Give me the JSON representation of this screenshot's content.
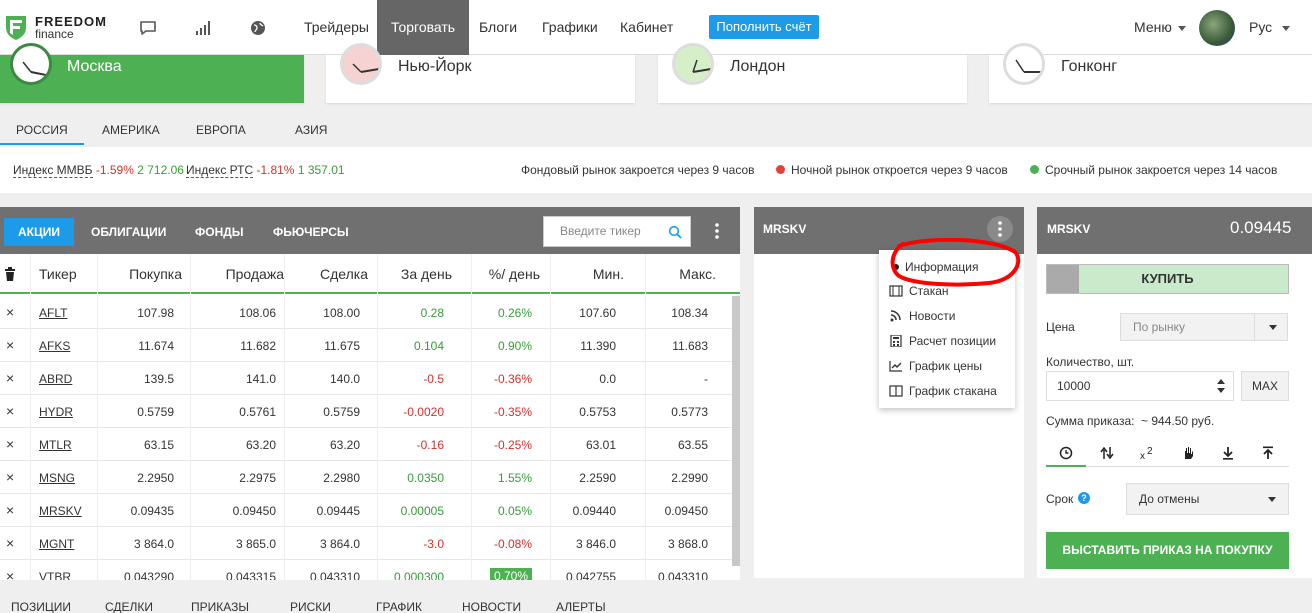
{
  "header": {
    "logo_top": "FREEDOM",
    "logo_bottom": "finance",
    "nav": [
      "Трейдеры",
      "Торговать",
      "Блоги",
      "Графики",
      "Кабинет"
    ],
    "deposit": "Пополнить счёт",
    "menu": "Меню",
    "lang": "Рус"
  },
  "clocks": [
    "Москва",
    "Нью-Йорк",
    "Лондон",
    "Гонконг"
  ],
  "regions": [
    "РОССИЯ",
    "АМЕРИКА",
    "ЕВРОПА",
    "АЗИЯ"
  ],
  "indices": {
    "micex_label": "Индекс ММВБ",
    "micex_change": "-1.59%",
    "micex_value": "2 712.06",
    "rts_label": "Индекс РТС",
    "rts_change": "-1.81%",
    "rts_value": "1 357.01",
    "stock_status": "Фондовый рынок закроется через 9 часов",
    "night_status": "Ночной рынок откроется через 9 часов",
    "futures_status": "Срочный рынок закроется через 14 часов",
    "night_color": "#e2403a",
    "futures_color": "#4db153"
  },
  "table_tabs": [
    "АКЦИИ",
    "ОБЛИГАЦИИ",
    "ФОНДЫ",
    "ФЬЮЧЕРСЫ"
  ],
  "ticker_placeholder": "Введите тикер",
  "columns": [
    "Тикер",
    "Покупка",
    "Продажа",
    "Сделка",
    "За день",
    "%/ день",
    "Мин.",
    "Макс."
  ],
  "rows": [
    {
      "ticker": "AFLT",
      "bid": "107.98",
      "ask": "108.06",
      "last": "108.00",
      "chg": "0.28",
      "pct": "0.26%",
      "min": "107.60",
      "max": "108.34",
      "dir": "up"
    },
    {
      "ticker": "AFKS",
      "bid": "11.674",
      "ask": "11.682",
      "last": "11.675",
      "chg": "0.104",
      "pct": "0.90%",
      "min": "11.390",
      "max": "11.683",
      "dir": "up"
    },
    {
      "ticker": "ABRD",
      "bid": "139.5",
      "ask": "141.0",
      "last": "140.0",
      "chg": "-0.5",
      "pct": "-0.36%",
      "min": "0.0",
      "max": "-",
      "dir": "down"
    },
    {
      "ticker": "HYDR",
      "bid": "0.5759",
      "ask": "0.5761",
      "last": "0.5759",
      "chg": "-0.0020",
      "pct": "-0.35%",
      "min": "0.5753",
      "max": "0.5773",
      "dir": "down"
    },
    {
      "ticker": "MTLR",
      "bid": "63.15",
      "ask": "63.20",
      "last": "63.20",
      "chg": "-0.16",
      "pct": "-0.25%",
      "min": "63.01",
      "max": "63.55",
      "dir": "down"
    },
    {
      "ticker": "MSNG",
      "bid": "2.2950",
      "ask": "2.2975",
      "last": "2.2980",
      "chg": "0.0350",
      "pct": "1.55%",
      "min": "2.2590",
      "max": "2.2990",
      "dir": "up"
    },
    {
      "ticker": "MRSKV",
      "bid": "0.09435",
      "ask": "0.09450",
      "last": "0.09445",
      "chg": "0.00005",
      "pct": "0.05%",
      "min": "0.09440",
      "max": "0.09450",
      "dir": "up"
    },
    {
      "ticker": "MGNT",
      "bid": "3 864.0",
      "ask": "3 865.0",
      "last": "3 864.0",
      "chg": "-3.0",
      "pct": "-0.08%",
      "min": "3 846.0",
      "max": "3 868.0",
      "dir": "down"
    },
    {
      "ticker": "VTBR",
      "bid": "0.043290",
      "ask": "0.043315",
      "last": "0.043310",
      "chg": "0.000300",
      "pct": "0.70%",
      "min": "0.042755",
      "max": "0.043310",
      "dir": "up"
    }
  ],
  "middle": {
    "title": "MRSKV",
    "menu": [
      "Информация",
      "Стакан",
      "Новости",
      "Расчет позиции",
      "График цены",
      "График стакана"
    ]
  },
  "order": {
    "title": "MRSKV",
    "price": "0.09445",
    "buy": "КУПИТЬ",
    "price_label": "Цена",
    "price_value": "По рынку",
    "qty_label": "Количество, шт.",
    "qty_value": "10000",
    "max": "MAX",
    "sum_label": "Сумма приказа:",
    "sum_value": "~ 944.50 руб.",
    "term_label": "Срок",
    "term_value": "До отмены",
    "submit": "ВЫСТАВИТЬ ПРИКАЗ НА ПОКУПКУ"
  },
  "bottom_tabs": [
    "ПОЗИЦИИ",
    "СДЕЛКИ",
    "ПРИКАЗЫ",
    "РИСКИ",
    "ГРАФИК",
    "НОВОСТИ",
    "АЛЕРТЫ"
  ]
}
